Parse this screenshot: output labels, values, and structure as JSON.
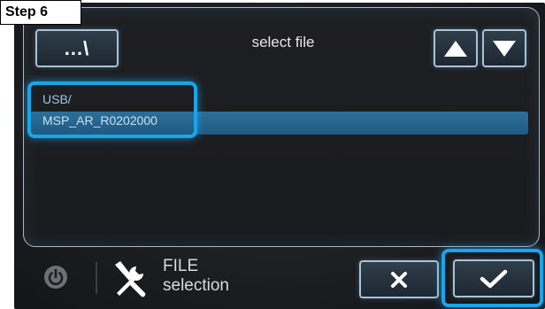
{
  "step_label": "Step 6",
  "header": {
    "path_button_label": "...\\",
    "title": "select file"
  },
  "file_list": {
    "items": [
      "USB/",
      "MSP_AR_R0202000"
    ],
    "selected_index": 1
  },
  "footer": {
    "mode_line1": "FILE",
    "mode_line2": "selection"
  },
  "icons": {
    "up": "up-arrow-icon",
    "down": "down-arrow-icon",
    "power": "power-icon",
    "tools": "tools-icon",
    "cancel": "cross-icon",
    "confirm": "checkmark-icon"
  },
  "colors": {
    "highlight": "#1aa4ea",
    "selection_bar": "#2d6f99"
  }
}
